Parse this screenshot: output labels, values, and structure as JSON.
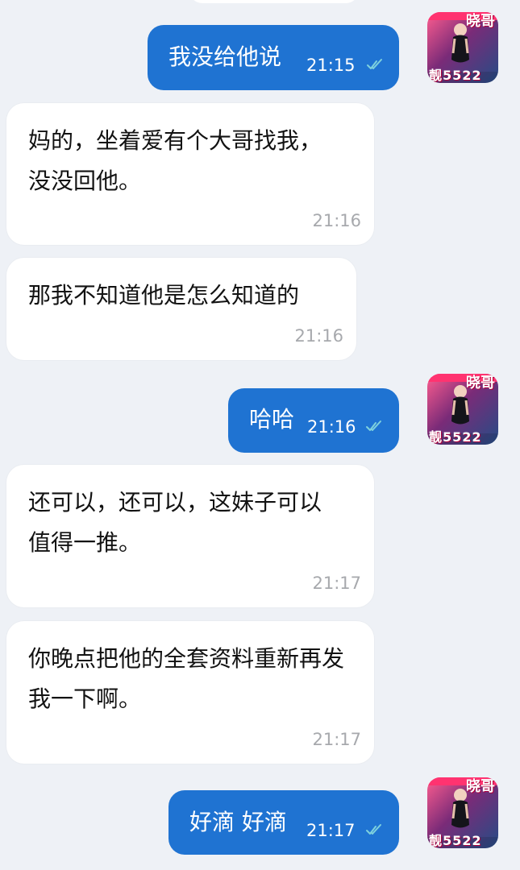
{
  "messages": [
    {
      "type": "outgoing",
      "text": "我没给他说",
      "time": "21:15"
    },
    {
      "type": "incoming",
      "text": "妈的，坐着爱有个大哥找我，没没回他。",
      "time": "21:16"
    },
    {
      "type": "incoming",
      "text": "那我不知道他是怎么知道的",
      "time": "21:16"
    },
    {
      "type": "outgoing",
      "text": "哈哈",
      "time": "21:16"
    },
    {
      "type": "incoming",
      "text": "还可以，还可以，这妹子可以值得一推。",
      "time": "21:17"
    },
    {
      "type": "incoming",
      "text": "你晚点把他的全套资料重新再发我一下啊。",
      "time": "21:17"
    },
    {
      "type": "outgoing",
      "text": "好滴 好滴",
      "time": "21:17"
    }
  ],
  "avatar": {
    "label_top": "晓哥",
    "label_bottom": "靓5522"
  },
  "colors": {
    "background": "#eef1f6",
    "outgoing_bubble": "#1f73d2",
    "incoming_bubble": "#ffffff",
    "timestamp_incoming": "#a7a9ad",
    "read_check": "#7ed1dd"
  },
  "icons": [
    "double-check-icon",
    "avatar-icon"
  ]
}
